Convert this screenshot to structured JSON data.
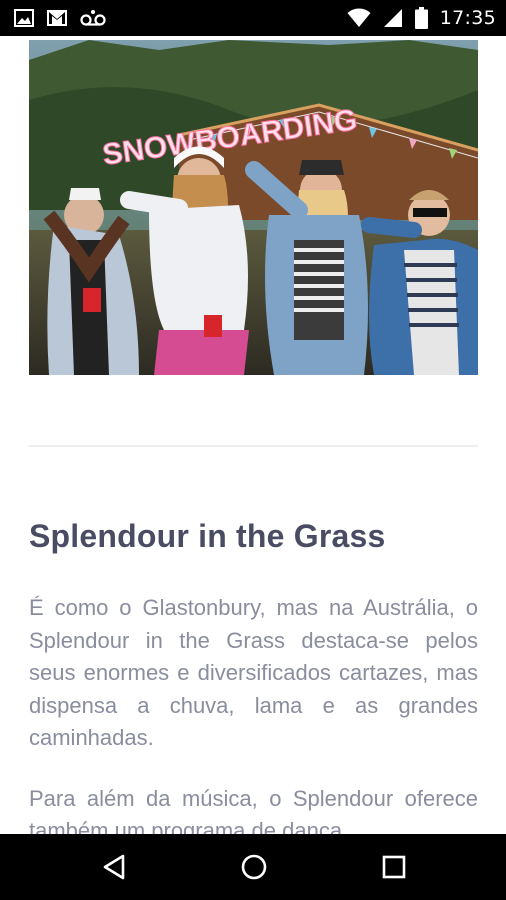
{
  "status_bar": {
    "time": "17:35",
    "icons": [
      "image-icon",
      "gmail-icon",
      "voicemail-icon",
      "wifi-icon",
      "signal-icon",
      "battery-icon"
    ]
  },
  "hero": {
    "sign_text": "SNOWBOARDING",
    "colors": {
      "sky": "#8fb3c7",
      "forest": "#3d5a2a",
      "sign_glow": "#ffd7e6"
    }
  },
  "article": {
    "title": "Splendour in the Grass",
    "paragraphs": [
      "É como o Glastonbury, mas na Austrália, o Splendour in the Grass destaca-se pelos seus enormes e diversificados cartazes, mas dispensa a chuva, lama e as grandes caminhadas.",
      "Para além da música, o Splendour oferece também um programa de dança"
    ]
  },
  "nav_bar": {
    "icons": [
      "back-icon",
      "home-icon",
      "recents-icon"
    ]
  }
}
